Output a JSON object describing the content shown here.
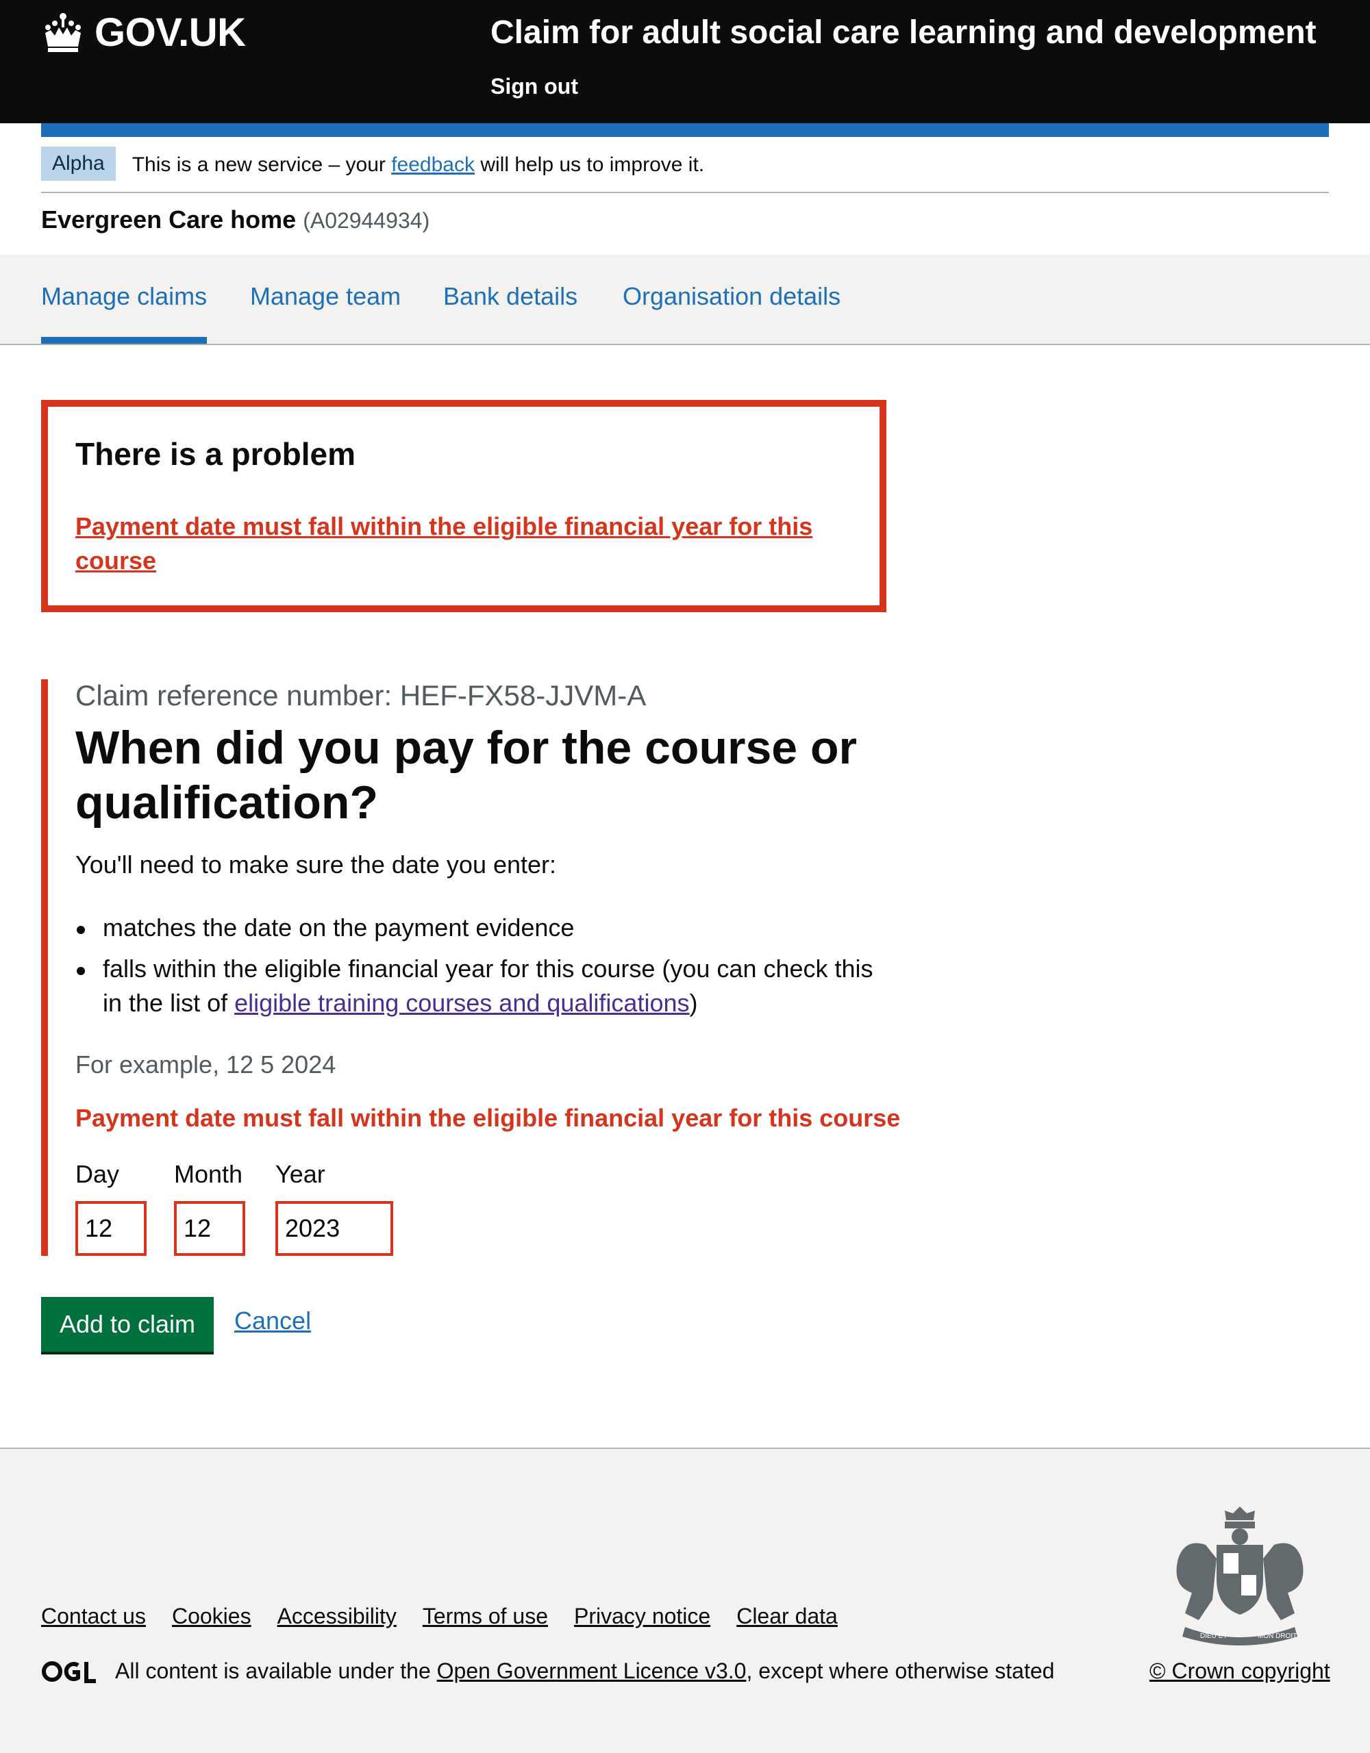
{
  "header": {
    "logo_text": "GOV.UK",
    "service_name": "Claim for adult social care learning and development",
    "sign_out": "Sign out"
  },
  "phase_banner": {
    "tag": "Alpha",
    "text_before": "This is a new service – your ",
    "link": "feedback",
    "text_after": " will help us to improve it."
  },
  "organisation": {
    "name": "Evergreen Care home",
    "id": "(A02944934)"
  },
  "nav": {
    "items": [
      {
        "label": "Manage claims",
        "active": true
      },
      {
        "label": "Manage team"
      },
      {
        "label": "Bank details"
      },
      {
        "label": "Organisation details"
      }
    ]
  },
  "error_summary": {
    "title": "There is a problem",
    "message": "Payment date must fall within the eligible financial year for this course"
  },
  "form": {
    "caption": "Claim reference number: HEF-FX58-JJVM-A",
    "heading": "When did you pay for the course or qualification?",
    "intro": "You'll need to make sure the date you enter:",
    "bullet_1": "matches the date on the payment evidence",
    "bullet_2_before": "falls within the eligible financial year for this course (you can check this in the list of ",
    "bullet_2_link": "eligible training courses and qualifications",
    "bullet_2_after": ")",
    "hint": "For example, 12 5 2024",
    "error": "Payment date must fall within the eligible financial year for this course",
    "day_label": "Day",
    "month_label": "Month",
    "year_label": "Year",
    "day_value": "12",
    "month_value": "12",
    "year_value": "2023"
  },
  "actions": {
    "submit": "Add to claim",
    "cancel": "Cancel"
  },
  "footer": {
    "links": [
      "Contact us",
      "Cookies",
      "Accessibility",
      "Terms of use",
      "Privacy notice",
      "Clear data"
    ],
    "licence_before": "All content is available under the ",
    "licence_link": "Open Government Licence v3.0",
    "licence_after": ", except where otherwise stated",
    "copyright": "© Crown copyright",
    "crest_text_left": "DIEU ET",
    "crest_text_right": "MON DROIT"
  },
  "colors": {
    "header_bg": "#0b0c0c",
    "brand_blue": "#1d70b8",
    "error_red": "#d4351c",
    "button_green": "#00703c"
  }
}
